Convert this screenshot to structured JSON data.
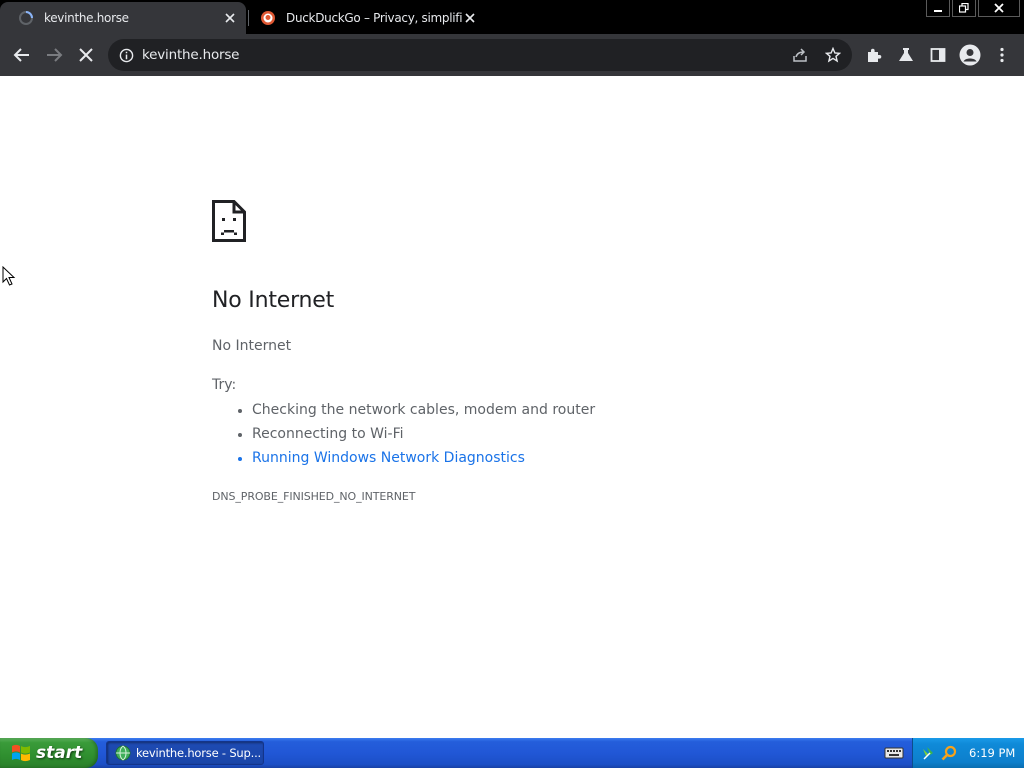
{
  "tabs": [
    {
      "title": "kevinthe.horse",
      "active": true
    },
    {
      "title": "DuckDuckGo – Privacy, simplified.",
      "active": false
    }
  ],
  "toolbar": {
    "url": "kevinthe.horse"
  },
  "error": {
    "title": "No Internet",
    "subtitle": "No Internet",
    "try_label": "Try:",
    "suggestions": [
      "Checking the network cables, modem and router",
      "Reconnecting to Wi-Fi",
      "Running Windows Network Diagnostics"
    ],
    "code": "DNS_PROBE_FINISHED_NO_INTERNET"
  },
  "taskbar": {
    "start_label": "start",
    "task_label": "kevinthe.horse - Sup...",
    "clock": "6:19 PM"
  },
  "colors": {
    "tabstrip_bg": "#000000",
    "toolbar_bg": "#35363a",
    "omnibox_bg": "#202124",
    "link": "#1a73e8",
    "text_secondary": "#5f6368",
    "taskbar_blue": "#245edb",
    "start_green": "#3a9b3a"
  }
}
